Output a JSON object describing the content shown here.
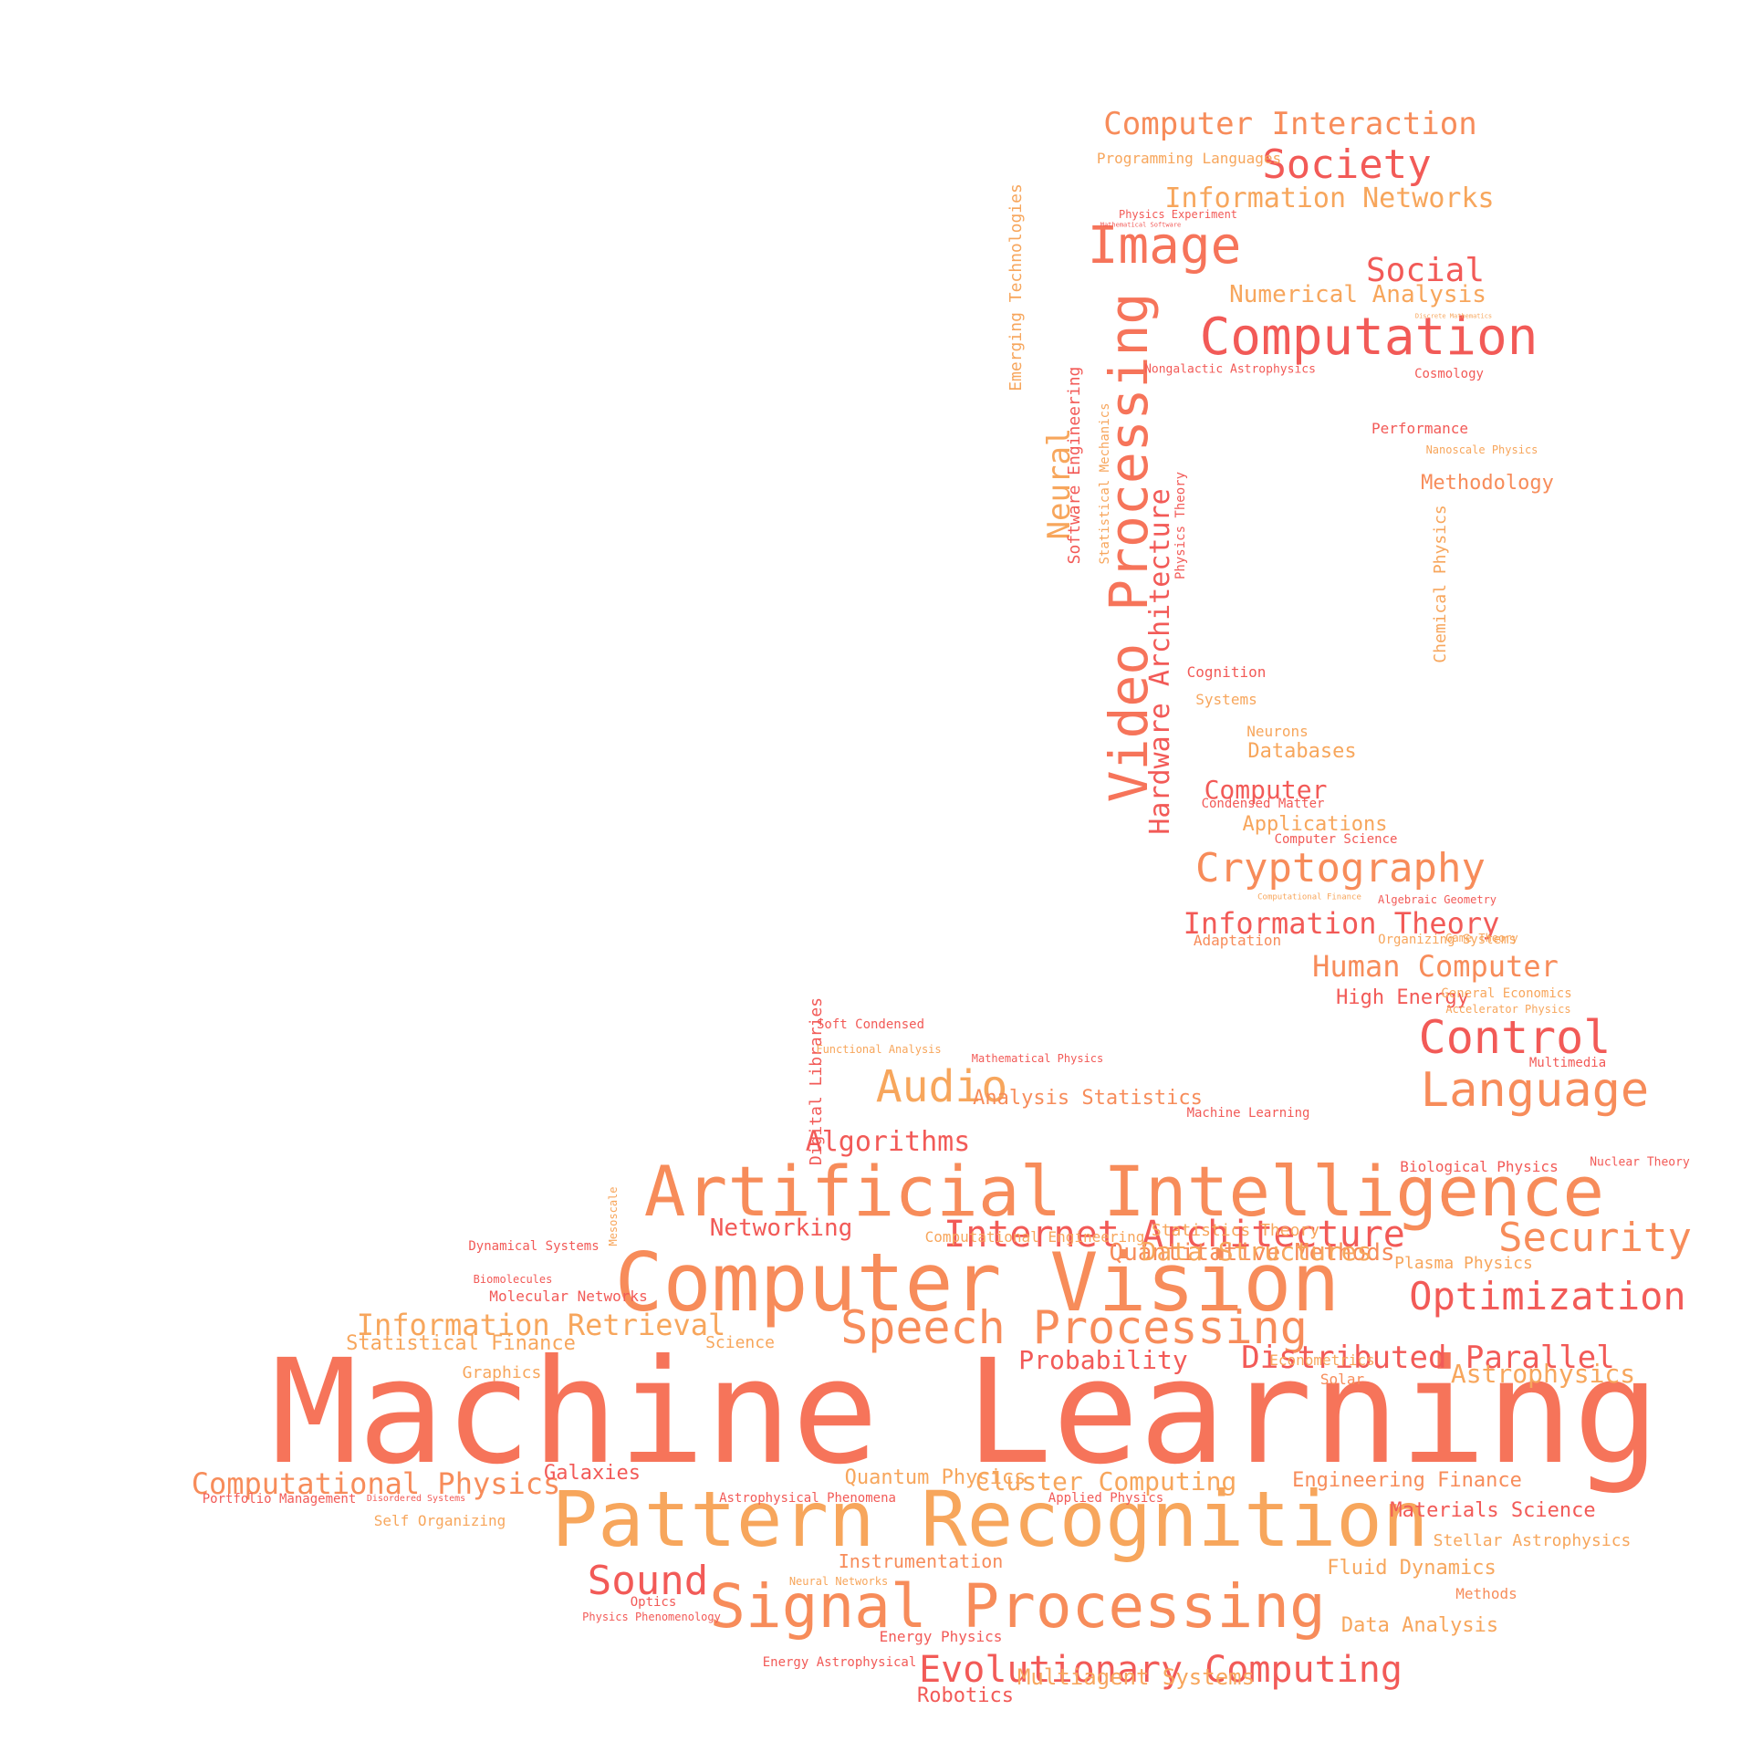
{
  "colors": {
    "red": "#f25a57",
    "coral": "#f6745a",
    "orange": "#f78c5a",
    "amber": "#f7a65c"
  },
  "words": [
    {
      "t": "Machine Learning",
      "c": "coral"
    },
    {
      "t": "Pattern Recognition",
      "c": "amber"
    },
    {
      "t": "Computer Vision",
      "c": "orange"
    },
    {
      "t": "Artificial Intelligence",
      "c": "orange"
    },
    {
      "t": "Signal Processing",
      "c": "orange"
    },
    {
      "t": "Speech Processing",
      "c": "orange"
    },
    {
      "t": "Evolutionary Computing",
      "c": "red"
    },
    {
      "t": "Sound",
      "c": "red"
    },
    {
      "t": "Computation",
      "c": "red"
    },
    {
      "t": "Image",
      "c": "coral"
    },
    {
      "t": "Video Processing",
      "c": "coral"
    },
    {
      "t": "Language",
      "c": "orange"
    },
    {
      "t": "Control",
      "c": "red"
    },
    {
      "t": "Cryptography",
      "c": "orange"
    },
    {
      "t": "Audio",
      "c": "amber"
    },
    {
      "t": "Security",
      "c": "orange"
    },
    {
      "t": "Optimization",
      "c": "red"
    },
    {
      "t": "Society",
      "c": "red"
    },
    {
      "t": "Social",
      "c": "red"
    },
    {
      "t": "Neural",
      "c": "amber"
    },
    {
      "t": "Hardware Architecture",
      "c": "red"
    },
    {
      "t": "Computer Interaction",
      "c": "orange"
    },
    {
      "t": "Information Networks",
      "c": "amber"
    },
    {
      "t": "Numerical Analysis",
      "c": "amber"
    },
    {
      "t": "Algorithms",
      "c": "red"
    },
    {
      "t": "Internet Architecture",
      "c": "red"
    },
    {
      "t": "Distributed Parallel",
      "c": "red"
    },
    {
      "t": "Information Retrieval",
      "c": "amber"
    },
    {
      "t": "Computational Physics",
      "c": "orange"
    },
    {
      "t": "Human Computer",
      "c": "orange"
    },
    {
      "t": "Information Theory",
      "c": "red"
    },
    {
      "t": "Cluster Computing",
      "c": "amber"
    },
    {
      "t": "Quantitative Methods",
      "c": "orange"
    },
    {
      "t": "Probability",
      "c": "red"
    },
    {
      "t": "Astrophysics",
      "c": "amber"
    },
    {
      "t": "Data Structures",
      "c": "amber"
    },
    {
      "t": "Computer",
      "c": "red"
    },
    {
      "t": "Networking",
      "c": "red"
    },
    {
      "t": "Quantum Physics",
      "c": "amber"
    },
    {
      "t": "Multiagent Systems",
      "c": "amber"
    },
    {
      "t": "Engineering Finance",
      "c": "orange"
    },
    {
      "t": "Materials Science",
      "c": "red"
    },
    {
      "t": "Instrumentation",
      "c": "orange"
    },
    {
      "t": "Fluid Dynamics",
      "c": "amber"
    },
    {
      "t": "Data Analysis",
      "c": "amber"
    },
    {
      "t": "Robotics",
      "c": "red"
    },
    {
      "t": "High Energy",
      "c": "red"
    },
    {
      "t": "Applications",
      "c": "amber"
    },
    {
      "t": "Analysis Statistics",
      "c": "orange"
    },
    {
      "t": "Galaxies",
      "c": "red"
    },
    {
      "t": "Methodology",
      "c": "orange"
    },
    {
      "t": "Plasma Physics",
      "c": "amber"
    },
    {
      "t": "Databases",
      "c": "amber"
    },
    {
      "t": "Statistical Finance",
      "c": "amber"
    },
    {
      "t": "Science",
      "c": "amber"
    },
    {
      "t": "Emerging Technologies",
      "c": "amber"
    },
    {
      "t": "Chemical Physics",
      "c": "amber"
    },
    {
      "t": "Software Engineering",
      "c": "red"
    },
    {
      "t": "Statistics Theory",
      "c": "amber"
    },
    {
      "t": "Computational Engineering",
      "c": "amber"
    },
    {
      "t": "Stellar Astrophysics",
      "c": "amber"
    },
    {
      "t": "Digital Libraries",
      "c": "red"
    },
    {
      "t": "Cognition",
      "c": "red"
    },
    {
      "t": "Systems",
      "c": "amber"
    },
    {
      "t": "Neurons",
      "c": "amber"
    },
    {
      "t": "Graphics",
      "c": "amber"
    },
    {
      "t": "Econometrics",
      "c": "amber"
    },
    {
      "t": "Methods",
      "c": "orange"
    },
    {
      "t": "Energy Physics",
      "c": "red"
    },
    {
      "t": "Programming Languages",
      "c": "amber"
    },
    {
      "t": "Biological Physics",
      "c": "red"
    },
    {
      "t": "Performance",
      "c": "red"
    },
    {
      "t": "Molecular Networks",
      "c": "red"
    },
    {
      "t": "Solar",
      "c": "orange"
    },
    {
      "t": "Adaptation",
      "c": "orange"
    },
    {
      "t": "Soft Condensed",
      "c": "red"
    },
    {
      "t": "Multimedia",
      "c": "red"
    },
    {
      "t": "Cosmology",
      "c": "red"
    },
    {
      "t": "Dynamical Systems",
      "c": "red"
    },
    {
      "t": "General Economics",
      "c": "amber"
    },
    {
      "t": "Optics",
      "c": "red"
    },
    {
      "t": "Portfolio Management",
      "c": "red"
    },
    {
      "t": "Self Organizing",
      "c": "amber"
    },
    {
      "t": "Condensed Matter",
      "c": "red"
    },
    {
      "t": "Computer Science",
      "c": "red"
    },
    {
      "t": "Applied Physics",
      "c": "red"
    },
    {
      "t": "Game Theory",
      "c": "amber"
    },
    {
      "t": "Machine Learning",
      "c": "red"
    },
    {
      "t": "Astrophysical Phenomena",
      "c": "red"
    },
    {
      "t": "Organizing Systems",
      "c": "amber"
    },
    {
      "t": "Energy Astrophysical",
      "c": "red"
    },
    {
      "t": "Physics Theory",
      "c": "red"
    },
    {
      "t": "Statistical Mechanics",
      "c": "amber"
    },
    {
      "t": "Nongalactic Astrophysics",
      "c": "red"
    },
    {
      "t": "Nuclear Theory",
      "c": "red"
    },
    {
      "t": "Accelerator Physics",
      "c": "amber"
    },
    {
      "t": "Biomolecules",
      "c": "red"
    },
    {
      "t": "Physics Experiment",
      "c": "red"
    },
    {
      "t": "Nanoscale Physics",
      "c": "amber"
    },
    {
      "t": "Mathematical Physics",
      "c": "red"
    },
    {
      "t": "Mesoscale",
      "c": "amber"
    },
    {
      "t": "Algebraic Geometry",
      "c": "red"
    },
    {
      "t": "Physics Phenomenology",
      "c": "red"
    },
    {
      "t": "Neural Networks",
      "c": "amber"
    },
    {
      "t": "Functional Analysis",
      "c": "amber"
    },
    {
      "t": "Disordered Systems",
      "c": "red"
    },
    {
      "t": "Computational Finance",
      "c": "amber"
    },
    {
      "t": "Mathematical Software",
      "c": "red"
    },
    {
      "t": "Discrete Mathematics",
      "c": "amber"
    },
    {
      "t": "Nuclear Experiment",
      "c": "red"
    }
  ]
}
